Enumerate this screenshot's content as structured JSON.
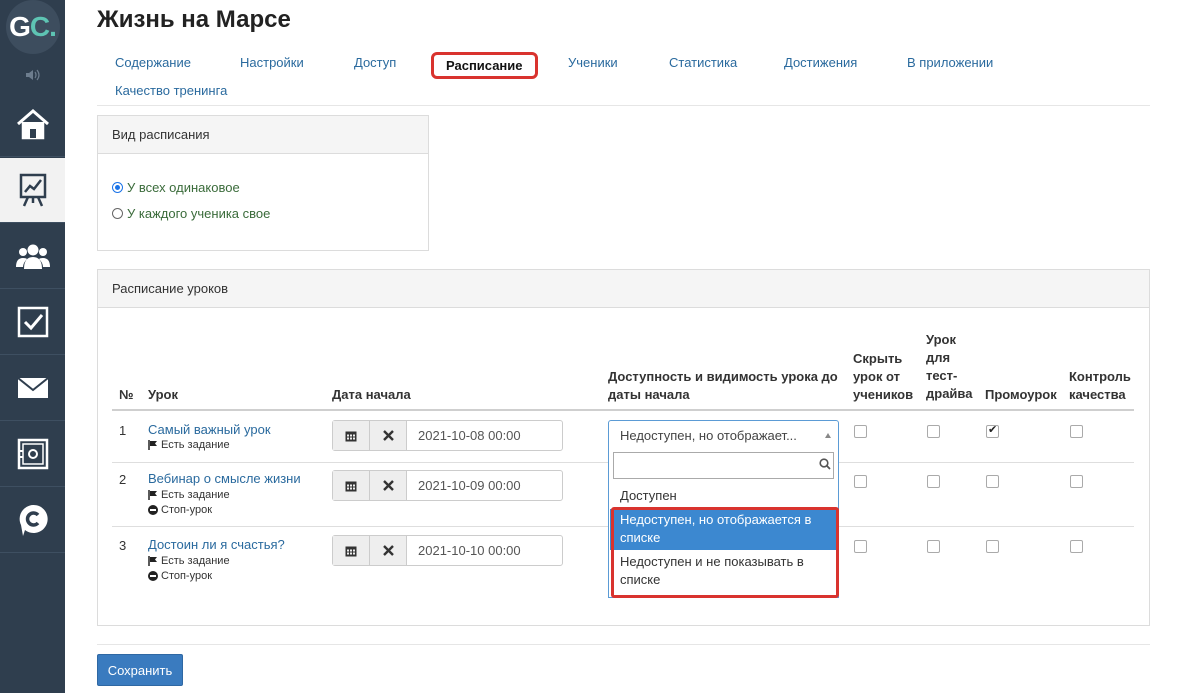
{
  "logo": {
    "g": "G",
    "c": "C",
    "dot": "."
  },
  "page_title": "Жизнь на Марсе",
  "tabs": [
    {
      "label": "Содержание"
    },
    {
      "label": "Настройки"
    },
    {
      "label": "Доступ"
    },
    {
      "label": "Расписание",
      "active": true
    },
    {
      "label": "Ученики"
    },
    {
      "label": "Статистика"
    },
    {
      "label": "Достижения"
    },
    {
      "label": "В приложении"
    },
    {
      "label": "Качество тренинга"
    }
  ],
  "schedule_type": {
    "title": "Вид расписания",
    "options": [
      {
        "label": "У всех одинаковое",
        "selected": true
      },
      {
        "label": "У каждого ученика свое",
        "selected": false
      }
    ]
  },
  "lessons_schedule": {
    "title": "Расписание уроков",
    "headers": {
      "num": "№",
      "lesson": "Урок",
      "start_date": "Дата начала",
      "availability_1": "Доступность и видимость урока до",
      "availability_2": "даты начала",
      "hide_1": "Скрыть",
      "hide_2": "урок от",
      "hide_3": "учеников",
      "test_1": "Урок",
      "test_2": "для",
      "test_3": "тест-",
      "test_4": "драйва",
      "promo": "Промоурок",
      "quality_1": "Контроль",
      "quality_2": "качества"
    },
    "rows": [
      {
        "num": "1",
        "title": "Самый важный урок",
        "has_task": "Есть задание",
        "stop": "",
        "date": "2021-10-08 00:00",
        "hide": false,
        "test_drive": false,
        "promo": true,
        "quality": false
      },
      {
        "num": "2",
        "title": "Вебинар о смысле жизни",
        "has_task": "Есть задание",
        "stop": "Стоп-урок",
        "date": "2021-10-09 00:00",
        "hide": false,
        "test_drive": false,
        "promo": false,
        "quality": false
      },
      {
        "num": "3",
        "title": "Достоин ли я счастья?",
        "has_task": "Есть задание",
        "stop": "Стоп-урок",
        "date": "2021-10-10 00:00",
        "hide": false,
        "test_drive": false,
        "promo": false,
        "quality": false
      }
    ]
  },
  "availability_select": {
    "value": "Недоступен, но отображает...",
    "search_value": "",
    "options": [
      {
        "line1": "Доступен",
        "line2": ""
      },
      {
        "line1": "Недоступен, но отображается в",
        "line2": "списке",
        "highlighted": true
      },
      {
        "line1": "Недоступен и не показывать в",
        "line2": "списке"
      }
    ]
  },
  "save_label": "Сохранить"
}
